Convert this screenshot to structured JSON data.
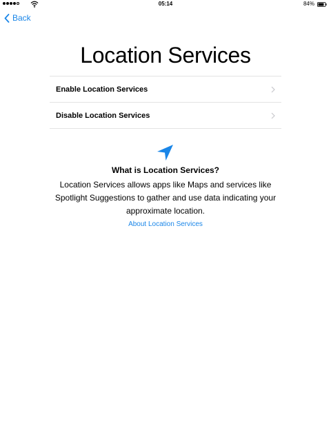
{
  "status_bar": {
    "time": "05:14",
    "battery_percent": "84%",
    "battery_level": 0.84,
    "signal_bars": 4,
    "signal_max": 5
  },
  "nav": {
    "back_label": "Back"
  },
  "page": {
    "title": "Location Services"
  },
  "options": [
    {
      "label": "Enable Location Services",
      "icon": "chevron-right-icon"
    },
    {
      "label": "Disable Location Services",
      "icon": "chevron-right-icon"
    }
  ],
  "info": {
    "icon": "location-arrow-icon",
    "title": "What is Location Services?",
    "body": "Location Services allows apps like Maps and services like Spotlight Suggestions to gather and use data indicating your approximate location.",
    "link": "About Location Services"
  },
  "colors": {
    "accent": "#1a86e8",
    "divider": "#e3e3e3",
    "chevron": "#c7c7cc"
  }
}
